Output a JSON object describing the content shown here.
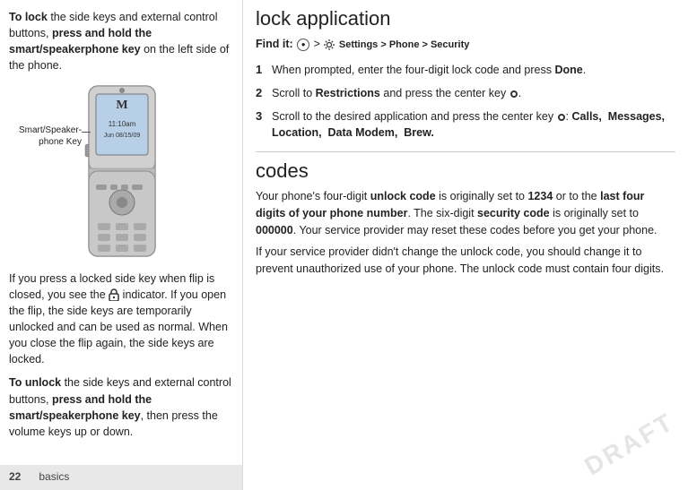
{
  "page": {
    "number": "22",
    "section": "basics"
  },
  "left_column": {
    "para1": "To lock the side keys and external control buttons, press and hold the smart/speakerphone key on the left side of the phone.",
    "para1_bold": "press and hold the smart/speakerphone key",
    "smart_speaker_label": "Smart/Speaker-phone Key",
    "para2": "If you press a locked side key when flip is closed, you see the",
    "para2_suffix": "indicator. If you open the flip, the side keys are temporarily unlocked and can be used as normal. When you close the flip again, the side keys are locked.",
    "para3_prefix": "To unlock the side keys and external control buttons,",
    "para3_bold": "press and hold the smart/speakerphone key",
    "para3_suffix": ", then press the volume keys up or down."
  },
  "right_column": {
    "section1": {
      "title": "lock application",
      "find_it_label": "Find it:",
      "find_it_path": "Settings > Phone > Security",
      "steps": [
        {
          "num": "1",
          "text": "When prompted, enter the four-digit lock code and press",
          "bold_word": "Done",
          "suffix": "."
        },
        {
          "num": "2",
          "text": "Scroll to",
          "bold_word": "Restrictions",
          "suffix": "and press the center key"
        },
        {
          "num": "3",
          "text": "Scroll to the desired application and press the center key",
          "bold_suffix": ": Calls,  Messages,  Location,  Data Modem,  Brew."
        }
      ]
    },
    "section2": {
      "title": "codes",
      "para1_prefix": "Your phone's four-digit",
      "para1_bold1": "unlock code",
      "para1_mid": "is originally set to",
      "para1_bold2": "1234",
      "para1_mid2": "or to the",
      "para1_bold3": "last four digits of your phone number",
      "para1_suffix": ". The six-digit",
      "para1_bold4": "security code",
      "para1_suffix2": "is originally set to",
      "para1_bold5": "000000",
      "para1_suffix3": ". Your service provider may reset these codes before you get your phone.",
      "para2": "If your service provider didn't change the unlock code, you should change it to prevent unauthorized use of your phone. The unlock code must contain four digits."
    }
  },
  "draft_watermark": "DRAFT"
}
